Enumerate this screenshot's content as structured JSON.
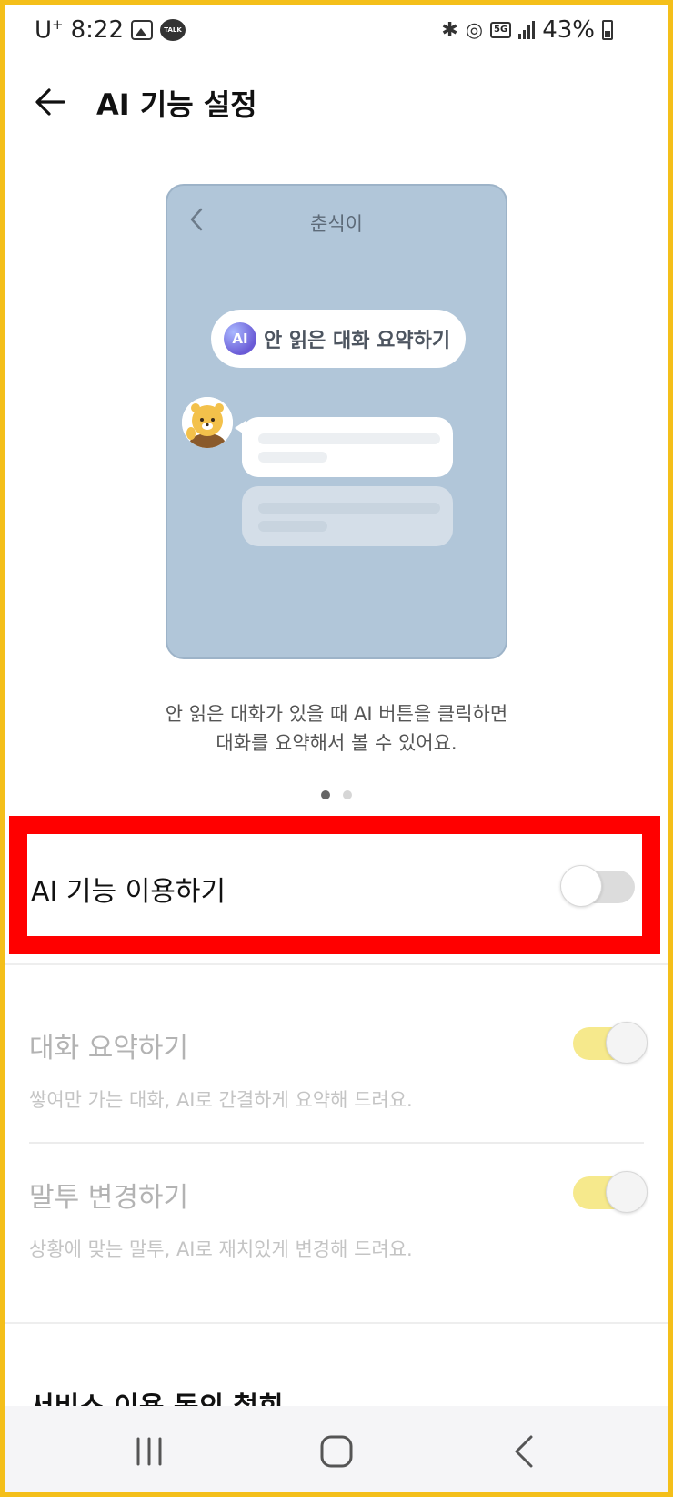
{
  "status_bar": {
    "carrier": "U",
    "carrier_sup": "+",
    "time": "8:22",
    "talk_badge": "TALK",
    "network_badge": "5G",
    "battery": "43%",
    "icons": [
      "image-icon",
      "kakaotalk-icon",
      "bluetooth-icon",
      "hotspot-icon",
      "5g-icon",
      "signal-icon",
      "battery-icon"
    ]
  },
  "header": {
    "title": "AI 기능 설정",
    "back_icon": "arrow-left-icon"
  },
  "illustration": {
    "chat_title": "춘식이",
    "ai_badge": "AI",
    "ai_button_text": "안 읽은 대화 요약하기",
    "card_color": "#b1c6d9"
  },
  "description": {
    "line1": "안 읽은 대화가 있을 때 AI 버튼을 클릭하면",
    "line2": "대화를 요약해서 볼 수 있어요."
  },
  "pager": {
    "current": 1,
    "total": 2
  },
  "ai_feature": {
    "label": "AI 기능 이용하기",
    "enabled": false
  },
  "settings": [
    {
      "title": "대화 요약하기",
      "subtitle": "쌓여만 가는 대화, AI로 간결하게 요약해 드려요.",
      "enabled": true,
      "disabled_state": true
    },
    {
      "title": "말투 변경하기",
      "subtitle": "상황에 맞는 말투, AI로 재치있게 변경해 드려요.",
      "enabled": true,
      "disabled_state": true
    }
  ],
  "service_consent": {
    "label": "서비스 이용 동의 철회"
  },
  "colors": {
    "highlight": "#ff0000",
    "frame": "#f4bf1a",
    "toggle_on": "#f6e98c",
    "toggle_off": "#dcdcdc"
  },
  "nav_bar": {
    "buttons": [
      "recent-apps-icon",
      "home-icon",
      "back-icon"
    ]
  }
}
